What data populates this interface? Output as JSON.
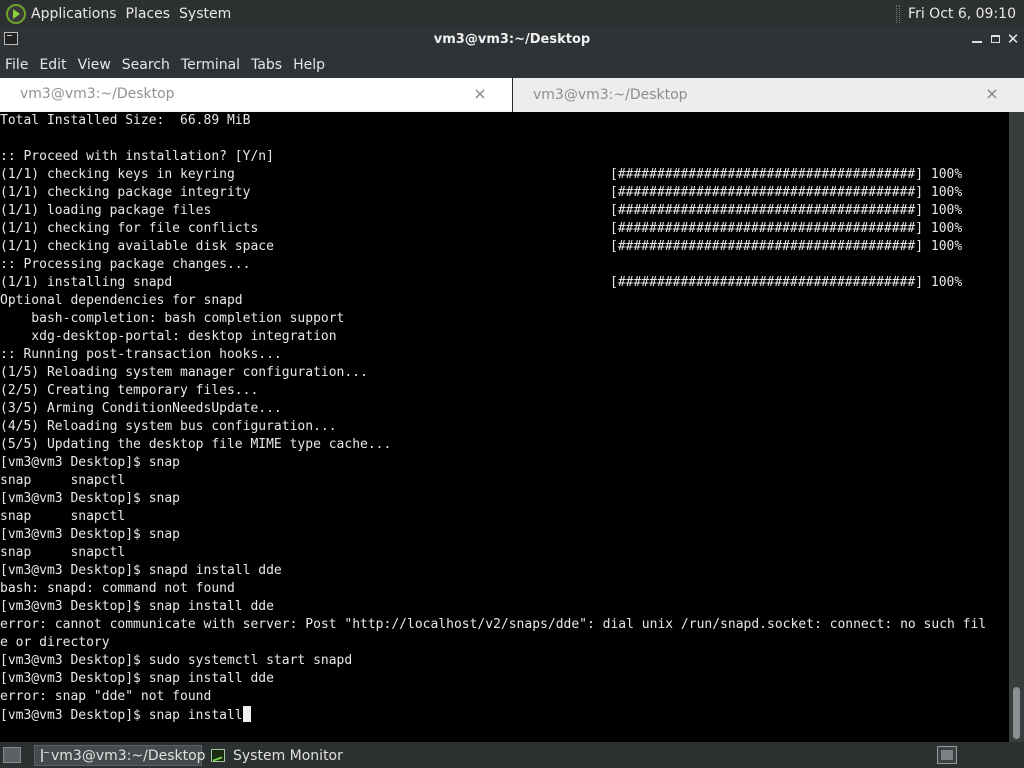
{
  "top_panel": {
    "menus": [
      "Applications",
      "Places",
      "System"
    ],
    "clock": "Fri Oct  6, 09:10"
  },
  "window": {
    "title": "vm3@vm3:~/Desktop"
  },
  "menubar": {
    "items": [
      "File",
      "Edit",
      "View",
      "Search",
      "Terminal",
      "Tabs",
      "Help"
    ]
  },
  "tabs": [
    {
      "label": "vm3@vm3:~/Desktop",
      "close": "×"
    },
    {
      "label": "vm3@vm3:~/Desktop",
      "close": "×"
    }
  ],
  "terminal": {
    "lines": [
      {
        "text": "Total Installed Size:  66.89 MiB",
        "right": ""
      },
      {
        "text": "",
        "right": ""
      },
      {
        "text": ":: Proceed with installation? [Y/n]",
        "right": ""
      },
      {
        "text": "(1/1) checking keys in keyring",
        "right": "[######################################] 100%"
      },
      {
        "text": "(1/1) checking package integrity",
        "right": "[######################################] 100%"
      },
      {
        "text": "(1/1) loading package files",
        "right": "[######################################] 100%"
      },
      {
        "text": "(1/1) checking for file conflicts",
        "right": "[######################################] 100%"
      },
      {
        "text": "(1/1) checking available disk space",
        "right": "[######################################] 100%"
      },
      {
        "text": ":: Processing package changes...",
        "right": ""
      },
      {
        "text": "(1/1) installing snapd",
        "right": "[######################################] 100%"
      },
      {
        "text": "Optional dependencies for snapd",
        "right": ""
      },
      {
        "text": "    bash-completion: bash completion support",
        "right": ""
      },
      {
        "text": "    xdg-desktop-portal: desktop integration",
        "right": ""
      },
      {
        "text": ":: Running post-transaction hooks...",
        "right": ""
      },
      {
        "text": "(1/5) Reloading system manager configuration...",
        "right": ""
      },
      {
        "text": "(2/5) Creating temporary files...",
        "right": ""
      },
      {
        "text": "(3/5) Arming ConditionNeedsUpdate...",
        "right": ""
      },
      {
        "text": "(4/5) Reloading system bus configuration...",
        "right": ""
      },
      {
        "text": "(5/5) Updating the desktop file MIME type cache...",
        "right": ""
      },
      {
        "text": "[vm3@vm3 Desktop]$ snap",
        "right": ""
      },
      {
        "text": "snap     snapctl",
        "right": ""
      },
      {
        "text": "[vm3@vm3 Desktop]$ snap",
        "right": ""
      },
      {
        "text": "snap     snapctl",
        "right": ""
      },
      {
        "text": "[vm3@vm3 Desktop]$ snap",
        "right": ""
      },
      {
        "text": "snap     snapctl",
        "right": ""
      },
      {
        "text": "[vm3@vm3 Desktop]$ snapd install dde",
        "right": ""
      },
      {
        "text": "bash: snapd: command not found",
        "right": ""
      },
      {
        "text": "[vm3@vm3 Desktop]$ snap install dde",
        "right": ""
      },
      {
        "text": "error: cannot communicate with server: Post \"http://localhost/v2/snaps/dde\": dial unix /run/snapd.socket: connect: no such fil",
        "right": ""
      },
      {
        "text": "e or directory",
        "right": ""
      },
      {
        "text": "[vm3@vm3 Desktop]$ sudo systemctl start snapd",
        "right": ""
      },
      {
        "text": "[vm3@vm3 Desktop]$ snap install dde",
        "right": ""
      },
      {
        "text": "error: snap \"dde\" not found",
        "right": ""
      }
    ],
    "prompt_line": "[vm3@vm3 Desktop]$ snap install"
  },
  "taskbar": {
    "tasks": [
      {
        "label": "vm3@vm3:~/Desktop",
        "icon": "terminal-icon"
      },
      {
        "label": "System Monitor",
        "icon": "system-monitor-icon"
      }
    ]
  }
}
